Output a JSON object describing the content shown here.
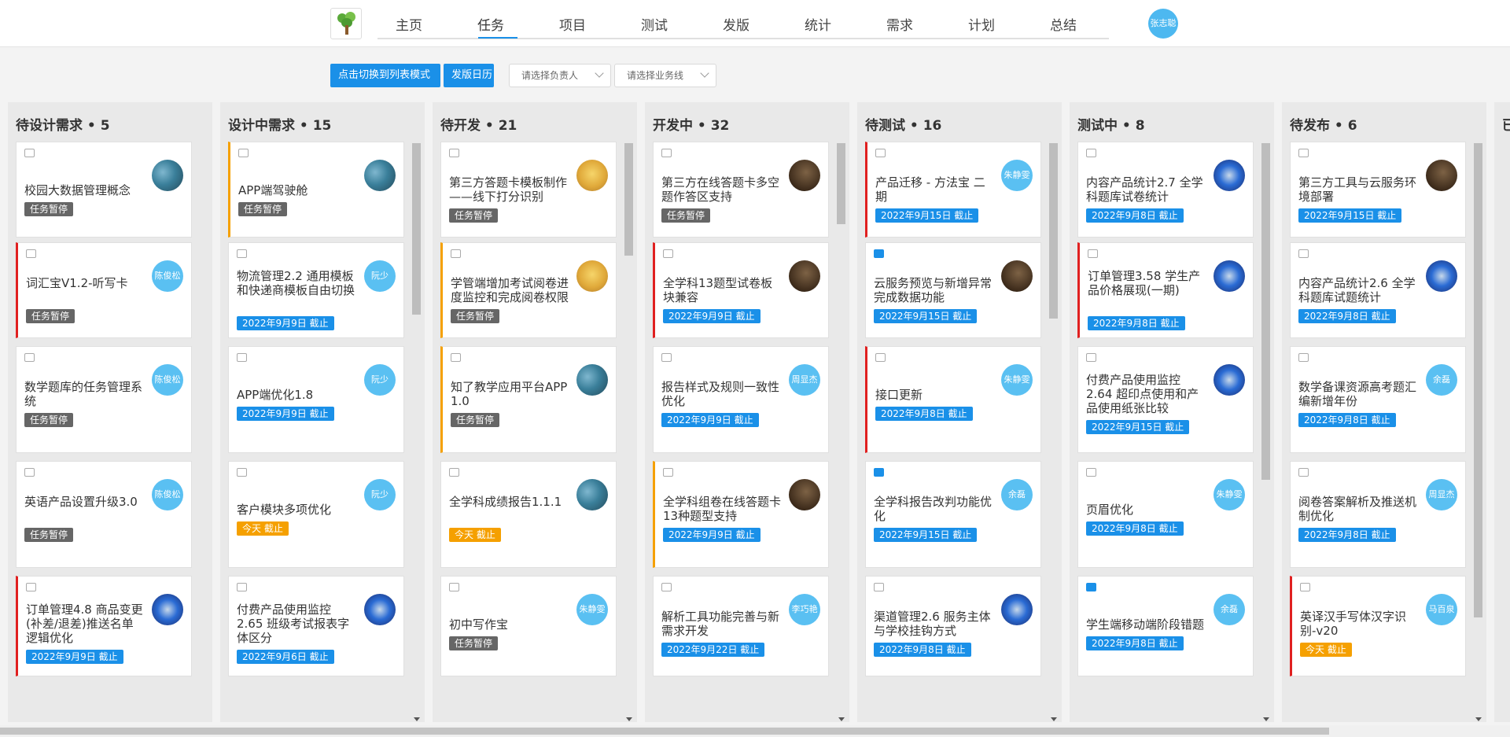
{
  "header": {
    "nav": [
      "主页",
      "任务",
      "项目",
      "测试",
      "发版",
      "统计",
      "需求",
      "计划",
      "总结"
    ],
    "active_index": 1,
    "user_avatar": "张志聪"
  },
  "toolbar": {
    "switch_label": "点击切换到列表模式",
    "calendar_label": "发版日历",
    "owner_placeholder": "请选择负责人",
    "business_placeholder": "请选择业务线"
  },
  "columns": [
    {
      "title": "待设计需求 • 5",
      "cards": [
        {
          "title": "校园大数据管理概念",
          "tag": "任务暂停",
          "tag_type": "gray",
          "avatar": "",
          "avatar_type": "img1",
          "border": "none",
          "icon": "gray"
        },
        {
          "title": "词汇宝V1.2-听写卡",
          "tag": "任务暂停",
          "tag_type": "gray",
          "avatar": "陈俊松",
          "avatar_type": "text",
          "border": "red",
          "icon": "gray"
        },
        {
          "title": "数学题库的任务管理系统",
          "tag": "任务暂停",
          "tag_type": "gray",
          "avatar": "陈俊松",
          "avatar_type": "text",
          "border": "none",
          "icon": "gray"
        },
        {
          "title": "英语产品设置升级3.0",
          "tag": "任务暂停",
          "tag_type": "gray",
          "avatar": "陈俊松",
          "avatar_type": "text",
          "border": "none",
          "icon": "gray"
        },
        {
          "title": "订单管理4.8 商品变更(补差/退差)推送名单逻辑优化",
          "tag": "2022年9月9日 截止",
          "tag_type": "blue",
          "avatar": "",
          "avatar_type": "img4",
          "border": "red",
          "icon": "gray"
        }
      ]
    },
    {
      "title": "设计中需求 • 15",
      "cards": [
        {
          "title": "APP端驾驶舱",
          "tag": "任务暂停",
          "tag_type": "gray",
          "avatar": "",
          "avatar_type": "img1",
          "border": "orange",
          "icon": "gray"
        },
        {
          "title": "物流管理2.2 通用模板和快递商模板自由切换",
          "tag": "2022年9月9日 截止",
          "tag_type": "blue",
          "avatar": "阮少",
          "avatar_type": "text",
          "border": "none",
          "icon": "gray"
        },
        {
          "title": "APP端优化1.8",
          "tag": "2022年9月9日 截止",
          "tag_type": "blue",
          "avatar": "阮少",
          "avatar_type": "text",
          "border": "none",
          "icon": "gray"
        },
        {
          "title": "客户模块多项优化",
          "tag": "今天 截止",
          "tag_type": "orange",
          "avatar": "阮少",
          "avatar_type": "text",
          "border": "none",
          "icon": "gray"
        },
        {
          "title": "付费产品使用监控2.65 班级考试报表字体区分",
          "tag": "2022年9月6日 截止",
          "tag_type": "blue",
          "avatar": "",
          "avatar_type": "img4",
          "border": "none",
          "icon": "gray"
        }
      ]
    },
    {
      "title": "待开发 • 21",
      "cards": [
        {
          "title": "第三方答题卡模板制作——线下打分识别",
          "tag": "任务暂停",
          "tag_type": "gray",
          "avatar": "",
          "avatar_type": "img2",
          "border": "none",
          "icon": "gray"
        },
        {
          "title": "学管端增加考试阅卷进度监控和完成阅卷权限",
          "tag": "任务暂停",
          "tag_type": "gray",
          "avatar": "",
          "avatar_type": "img2",
          "border": "orange",
          "icon": "gray"
        },
        {
          "title": "知了教学应用平台APP 1.0",
          "tag": "任务暂停",
          "tag_type": "gray",
          "avatar": "",
          "avatar_type": "img1",
          "border": "orange",
          "icon": "gray"
        },
        {
          "title": "全学科成绩报告1.1.1",
          "tag": "今天 截止",
          "tag_type": "orange",
          "avatar": "",
          "avatar_type": "img1",
          "border": "none",
          "icon": "gray"
        },
        {
          "title": "初中写作宝",
          "tag": "任务暂停",
          "tag_type": "gray",
          "avatar": "朱静雯",
          "avatar_type": "text",
          "border": "none",
          "icon": "gray"
        }
      ]
    },
    {
      "title": "开发中 • 32",
      "cards": [
        {
          "title": "第三方在线答题卡多空题作答区支持",
          "tag": "任务暂停",
          "tag_type": "gray",
          "avatar": "",
          "avatar_type": "img3",
          "border": "none",
          "icon": "gray"
        },
        {
          "title": "全学科13题型试卷板块兼容",
          "tag": "2022年9月9日 截止",
          "tag_type": "blue",
          "avatar": "",
          "avatar_type": "img3",
          "border": "red",
          "icon": "gray"
        },
        {
          "title": "报告样式及规则一致性优化",
          "tag": "2022年9月9日 截止",
          "tag_type": "blue",
          "avatar": "周显杰",
          "avatar_type": "text",
          "border": "none",
          "icon": "gray"
        },
        {
          "title": "全学科组卷在线答题卡13种题型支持",
          "tag": "2022年9月9日 截止",
          "tag_type": "blue",
          "avatar": "",
          "avatar_type": "img3",
          "border": "orange",
          "icon": "gray"
        },
        {
          "title": "解析工具功能完善与新需求开发",
          "tag": "2022年9月22日 截止",
          "tag_type": "blue",
          "avatar": "李巧艳",
          "avatar_type": "text",
          "border": "none",
          "icon": "gray"
        }
      ]
    },
    {
      "title": "待测试 • 16",
      "cards": [
        {
          "title": "产品迁移 - 方法宝 二期",
          "tag": "2022年9月15日 截止",
          "tag_type": "blue",
          "avatar": "朱静雯",
          "avatar_type": "text",
          "border": "red",
          "icon": "gray"
        },
        {
          "title": "云服务预览与新增异常完成数据功能",
          "tag": "2022年9月15日 截止",
          "tag_type": "blue",
          "avatar": "",
          "avatar_type": "img3",
          "border": "none",
          "icon": "blue"
        },
        {
          "title": "接口更新",
          "tag": "2022年9月8日 截止",
          "tag_type": "blue",
          "avatar": "朱静雯",
          "avatar_type": "text",
          "border": "red",
          "icon": "gray"
        },
        {
          "title": "全学科报告改判功能优化",
          "tag": "2022年9月15日 截止",
          "tag_type": "blue",
          "avatar": "余磊",
          "avatar_type": "text",
          "border": "none",
          "icon": "blue"
        },
        {
          "title": "渠道管理2.6 服务主体与学校挂钩方式",
          "tag": "2022年9月8日 截止",
          "tag_type": "blue",
          "avatar": "",
          "avatar_type": "img4",
          "border": "none",
          "icon": "gray"
        }
      ]
    },
    {
      "title": "测试中 • 8",
      "cards": [
        {
          "title": "内容产品统计2.7 全学科题库试卷统计",
          "tag": "2022年9月8日 截止",
          "tag_type": "blue",
          "avatar": "",
          "avatar_type": "img4",
          "border": "none",
          "icon": "gray"
        },
        {
          "title": "订单管理3.58 学生产品价格展现(一期)",
          "tag": "2022年9月8日 截止",
          "tag_type": "blue",
          "avatar": "",
          "avatar_type": "img4",
          "border": "red",
          "icon": "gray"
        },
        {
          "title": "付费产品使用监控2.64 超印点使用和产品使用纸张比较",
          "tag": "2022年9月15日 截止",
          "tag_type": "blue",
          "avatar": "",
          "avatar_type": "img4",
          "border": "none",
          "icon": "gray"
        },
        {
          "title": "页眉优化",
          "tag": "2022年9月8日 截止",
          "tag_type": "blue",
          "avatar": "朱静雯",
          "avatar_type": "text",
          "border": "none",
          "icon": "gray"
        },
        {
          "title": "学生端移动端阶段错题",
          "tag": "2022年9月8日 截止",
          "tag_type": "blue",
          "avatar": "余磊",
          "avatar_type": "text",
          "border": "none",
          "icon": "blue"
        }
      ]
    },
    {
      "title": "待发布 • 6",
      "cards": [
        {
          "title": "第三方工具与云服务环境部署",
          "tag": "2022年9月15日 截止",
          "tag_type": "blue",
          "avatar": "",
          "avatar_type": "img3",
          "border": "none",
          "icon": "gray"
        },
        {
          "title": "内容产品统计2.6 全学科题库试题统计",
          "tag": "2022年9月8日 截止",
          "tag_type": "blue",
          "avatar": "",
          "avatar_type": "img4",
          "border": "none",
          "icon": "gray"
        },
        {
          "title": "数学备课资源高考题汇编新增年份",
          "tag": "2022年9月8日 截止",
          "tag_type": "blue",
          "avatar": "余磊",
          "avatar_type": "text",
          "border": "none",
          "icon": "gray"
        },
        {
          "title": "阅卷答案解析及推送机制优化",
          "tag": "2022年9月8日 截止",
          "tag_type": "blue",
          "avatar": "周显杰",
          "avatar_type": "text",
          "border": "none",
          "icon": "gray"
        },
        {
          "title": "英译汉手写体汉字识别-v20",
          "tag": "今天 截止",
          "tag_type": "orange",
          "avatar": "马百泉",
          "avatar_type": "text",
          "border": "red",
          "icon": "gray"
        }
      ]
    },
    {
      "title": "已",
      "cards": []
    }
  ]
}
